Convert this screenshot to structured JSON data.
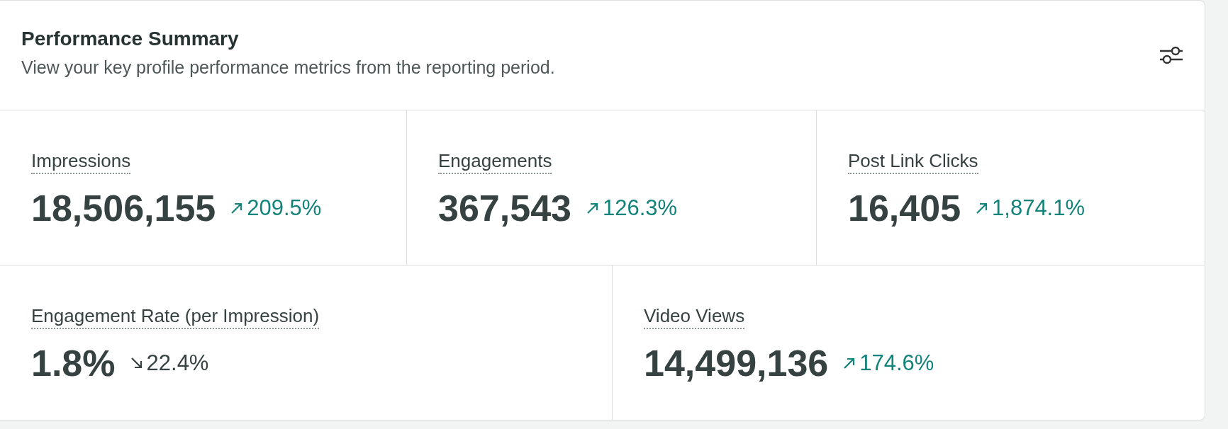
{
  "header": {
    "title": "Performance Summary",
    "subtitle": "View your key profile performance metrics from the reporting period."
  },
  "rows": [
    [
      {
        "label": "Impressions",
        "value": "18,506,155",
        "change": "209.5%",
        "kind": "up"
      },
      {
        "label": "Engagements",
        "value": "367,543",
        "change": "126.3%",
        "kind": "up"
      },
      {
        "label": "Post Link Clicks",
        "value": "16,405",
        "change": "1,874.1%",
        "kind": "up"
      }
    ],
    [
      {
        "label": "Engagement Rate (per Impression)",
        "value": "1.8%",
        "change": "22.4%",
        "kind": "down"
      },
      {
        "label": "Video Views",
        "value": "14,499,136",
        "change": "174.6%",
        "kind": "up"
      }
    ]
  ]
}
